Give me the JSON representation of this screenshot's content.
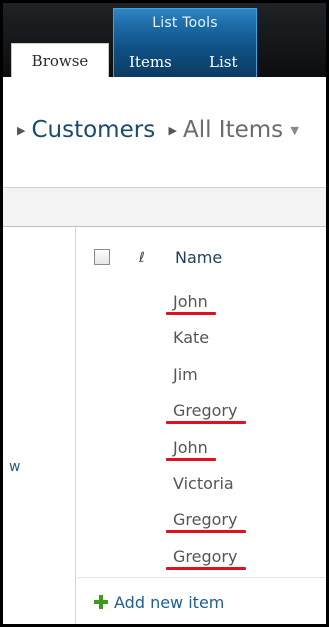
{
  "ribbon": {
    "context_group_label": "List Tools",
    "tabs": [
      {
        "label": "Browse",
        "selected": true
      },
      {
        "label": "Items",
        "selected": false
      },
      {
        "label": "List",
        "selected": false
      }
    ]
  },
  "breadcrumb": {
    "list_name": "Customers",
    "view_name": "All Items"
  },
  "leftnav": {
    "fragment_text": "w"
  },
  "list": {
    "column_header": "Name",
    "rows": [
      {
        "name": "John",
        "highlighted": true
      },
      {
        "name": "Kate",
        "highlighted": false
      },
      {
        "name": "Jim",
        "highlighted": false
      },
      {
        "name": "Gregory",
        "highlighted": true
      },
      {
        "name": "John",
        "highlighted": true
      },
      {
        "name": "Victoria",
        "highlighted": false
      },
      {
        "name": "Gregory",
        "highlighted": true
      },
      {
        "name": "Gregory",
        "highlighted": true
      }
    ],
    "add_new_label": "Add new item"
  },
  "colors": {
    "highlight_underline": "#e0101e",
    "link_blue": "#1e5f93",
    "ribbon_context": "#1b6aa6"
  }
}
